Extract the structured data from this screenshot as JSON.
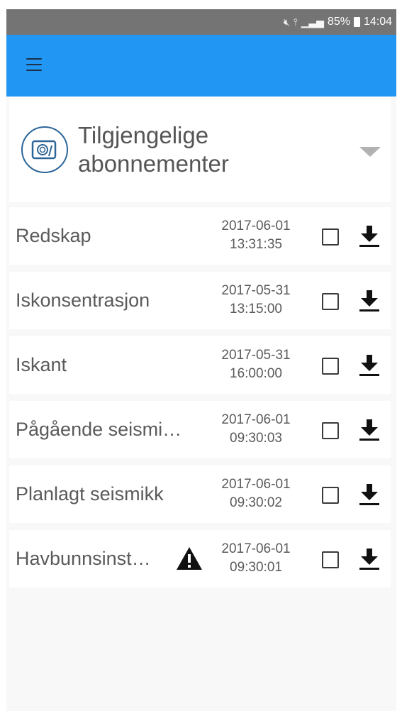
{
  "status_bar": {
    "mute_icon": "mute-icon",
    "wifi_icon": "wifi-icon",
    "signal_icon": "signal-icon",
    "battery": "85%",
    "time": "14:04"
  },
  "app_bar": {
    "color": "#2196f3",
    "menu_icon": "hamburger-menu-icon"
  },
  "header": {
    "title_line1": "Tilgjengelige",
    "title_line2": "abonnementer",
    "icon": "subscription-icon",
    "expand_icon": "chevron-down-icon"
  },
  "subscriptions": [
    {
      "name": "Redskap",
      "date": "2017-06-01",
      "time": "13:31:35",
      "checked": false,
      "warning": false
    },
    {
      "name": "Iskonsentrasjon",
      "date": "2017-05-31",
      "time": "13:15:00",
      "checked": false,
      "warning": false
    },
    {
      "name": "Iskant",
      "date": "2017-05-31",
      "time": "16:00:00",
      "checked": false,
      "warning": false
    },
    {
      "name": "Pågående seismi…",
      "date": "2017-06-01",
      "time": "09:30:03",
      "checked": false,
      "warning": false
    },
    {
      "name": "Planlagt seismikk",
      "date": "2017-06-01",
      "time": "09:30:02",
      "checked": false,
      "warning": false
    },
    {
      "name": "Havbunnsinst…",
      "date": "2017-06-01",
      "time": "09:30:01",
      "checked": false,
      "warning": true
    }
  ]
}
